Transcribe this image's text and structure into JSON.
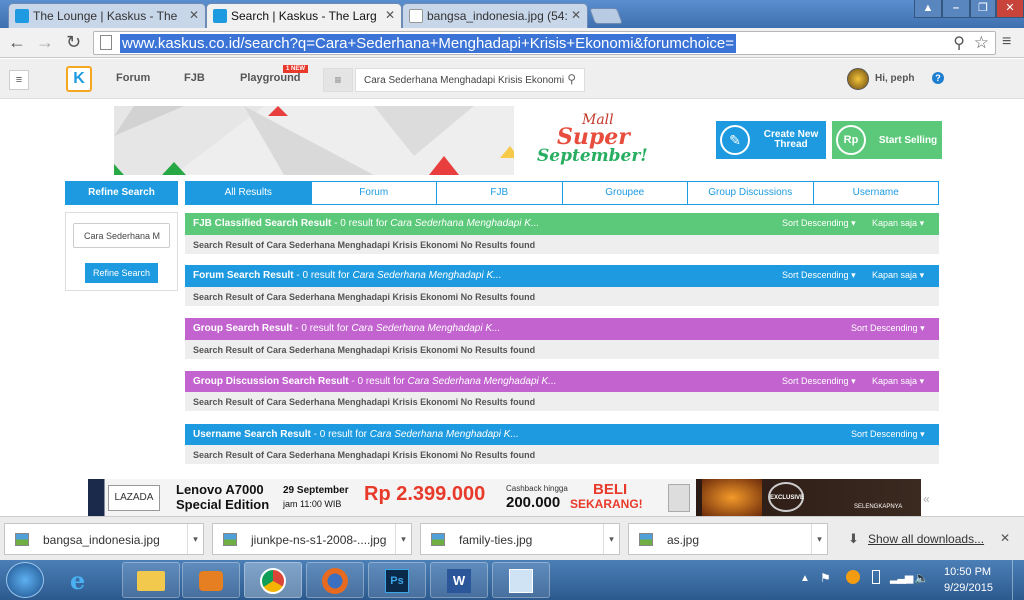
{
  "browser": {
    "tabs": [
      {
        "title": "The Lounge | Kaskus - The",
        "active": false
      },
      {
        "title": "Search | Kaskus - The Larg",
        "active": true
      },
      {
        "title": "bangsa_indonesia.jpg (54:",
        "active": false
      }
    ],
    "url": "www.kaskus.co.id/search?q=Cara+Sederhana+Menghadapi+Krisis+Ekonomi&forumchoice="
  },
  "header": {
    "nav": [
      "Forum",
      "FJB",
      "Playground"
    ],
    "new_badge": "1 NEW",
    "search_value": "Cara Sederhana Menghadapi Krisis Ekonomi",
    "user_greeting": "Hi, peph"
  },
  "banner": {
    "mall_label": "Mall",
    "promo_line1": "Super",
    "promo_line2": "September!"
  },
  "actions": {
    "create_thread": "Create New Thread",
    "start_selling": "Start Selling"
  },
  "refine": {
    "title": "Refine Search",
    "input_value": "Cara Sederhana M",
    "button": "Refine Search"
  },
  "result_tabs": [
    "All Results",
    "Forum",
    "FJB",
    "Groupee",
    "Group Discussions",
    "Username"
  ],
  "sections": [
    {
      "title": "FJB Classified Search Result",
      "count_text": " - 0 result for ",
      "query": "Cara Sederhana Menghadapi K...",
      "sort": "Sort Descending",
      "time": "Kapan saja",
      "color": "#5cc97a",
      "body": "Search Result of Cara Sederhana Menghadapi Krisis Ekonomi No Results found"
    },
    {
      "title": "Forum Search Result",
      "count_text": " - 0 result for ",
      "query": "Cara Sederhana Menghadapi K...",
      "sort": "Sort Descending",
      "time": "Kapan saja",
      "color": "#1e9be0",
      "body": "Search Result of Cara Sederhana Menghadapi Krisis Ekonomi No Results found"
    },
    {
      "title": "Group Search Result",
      "count_text": " - 0 result for ",
      "query": "Cara Sederhana Menghadapi K...",
      "sort": "Sort Descending",
      "time": "",
      "color": "#c263cf",
      "body": "Search Result of Cara Sederhana Menghadapi Krisis Ekonomi No Results found"
    },
    {
      "title": "Group Discussion Search Result",
      "count_text": " - 0 result for ",
      "query": "Cara Sederhana Menghadapi K...",
      "sort": "Sort Descending",
      "time": "Kapan saja",
      "color": "#c263cf",
      "body": "Search Result of Cara Sederhana Menghadapi Krisis Ekonomi No Results found"
    },
    {
      "title": "Username Search Result",
      "count_text": " - 0 result for ",
      "query": "Cara Sederhana Menghadapi K...",
      "sort": "Sort Descending",
      "time": "",
      "color": "#1e9be0",
      "body": "Search Result of Cara Sederhana Menghadapi Krisis Ekonomi No Results found"
    }
  ],
  "ad": {
    "brand": "LAZADA",
    "product": "Lenovo A7000",
    "edition": "Special Edition",
    "date": "29 September",
    "time": "jam 11:00 WIB",
    "price": "Rp 2.399.000",
    "cashback_label": "Cashback hingga",
    "cashback": "200.000",
    "cta1": "BELI",
    "cta2": "SEKARANG!",
    "exclusive": "EXCLUSIVE",
    "selengkapnya": "SELENGKAPNYA"
  },
  "downloads": {
    "items": [
      "bangsa_indonesia.jpg",
      "jiunkpe-ns-s1-2008-....jpg",
      "family-ties.jpg",
      "as.jpg"
    ],
    "show_all": "Show all downloads..."
  },
  "clock": {
    "time": "10:50 PM",
    "date": "9/29/2015"
  },
  "icons": [
    "menu-icon",
    "kaskus-logo-icon",
    "search-icon",
    "help-icon",
    "pencil-icon",
    "rupiah-icon",
    "star-icon",
    "zoom-icon",
    "back-icon",
    "forward-icon",
    "reload-icon"
  ]
}
